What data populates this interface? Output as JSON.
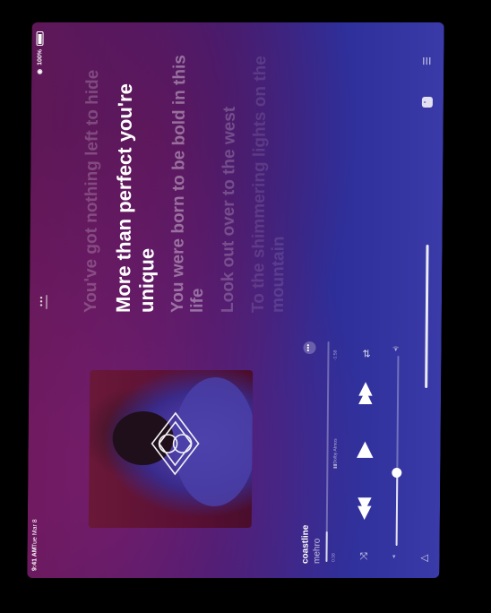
{
  "status_bar": {
    "time": "9:41 AM",
    "date": "Tue Mar 8",
    "battery": "100%"
  },
  "now_playing": {
    "title": "coastline",
    "artist": "mehro",
    "time_elapsed": "0:38",
    "time_remaining": "-1:58",
    "progress": 0.14,
    "badge": "Dolby Atmos",
    "volume": 0.38
  },
  "lyrics": [
    "You've got nothing left to hide",
    "More than perfect you're unique",
    "You were born to be bold in this life",
    "Look out over to the west",
    "To the shimmering lights on the mountain"
  ],
  "icons": {
    "more": "ellipsis-icon",
    "shuffle": "shuffle-icon",
    "previous": "backward-icon",
    "play": "play-icon",
    "next": "forward-icon",
    "repeat": "repeat-icon",
    "airplay": "airplay-icon",
    "lyrics": "lyrics-icon",
    "queue": "queue-icon"
  },
  "colors": {
    "accent": "#ffffff",
    "bg_left": "#5a1858",
    "bg_right": "#3a3aa8"
  }
}
